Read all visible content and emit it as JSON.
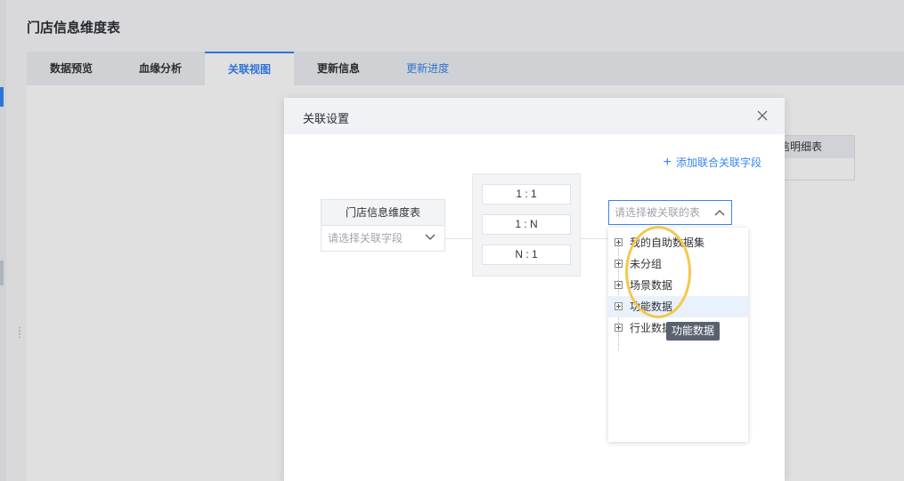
{
  "page": {
    "title": "门店信息维度表"
  },
  "tabs": [
    {
      "label": "数据预览"
    },
    {
      "label": "血缘分析"
    },
    {
      "label": "关联视图"
    },
    {
      "label": "更新信息"
    },
    {
      "label": "更新进度"
    }
  ],
  "background_table": {
    "header": "信明细表"
  },
  "modal": {
    "title": "关联设置",
    "add_field_label": "添加联合关联字段",
    "left_table": {
      "name": "门店信息维度表",
      "select_placeholder": "请选择关联字段"
    },
    "relations": [
      "1 : 1",
      "1 : N",
      "N : 1"
    ],
    "right_select_placeholder": "请选择被关联的表",
    "tree": [
      {
        "label": "我的自助数据集"
      },
      {
        "label": "未分组"
      },
      {
        "label": "场景数据"
      },
      {
        "label": "功能数据"
      },
      {
        "label": "行业数据"
      }
    ],
    "tooltip": "功能数据"
  },
  "colors": {
    "accent": "#3685f2",
    "highlight_ring": "#f3c84c"
  }
}
